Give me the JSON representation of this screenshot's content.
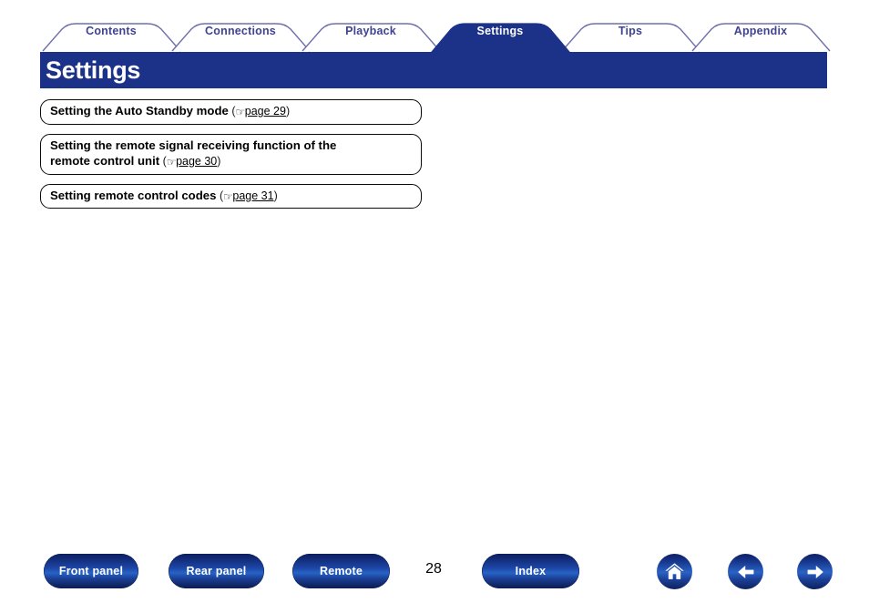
{
  "tabs": [
    {
      "label": "Contents",
      "active": false
    },
    {
      "label": "Connections",
      "active": false
    },
    {
      "label": "Playback",
      "active": false
    },
    {
      "label": "Settings",
      "active": true
    },
    {
      "label": "Tips",
      "active": false
    },
    {
      "label": "Appendix",
      "active": false
    }
  ],
  "header": {
    "title": "Settings",
    "bar_color": "#1b3288",
    "tab_border_color": "#6f70ab",
    "tab_text_color": "#404392"
  },
  "links": [
    {
      "lines": [
        "Setting the Auto Standby mode"
      ],
      "icon": "pointing-hand-icon",
      "page_ref": "page 29"
    },
    {
      "lines": [
        "Setting the remote signal receiving function of the",
        "remote control unit"
      ],
      "icon": "pointing-hand-icon",
      "page_ref": "page 30"
    },
    {
      "lines": [
        "Setting remote control codes"
      ],
      "icon": "pointing-hand-icon",
      "page_ref": "page 31"
    }
  ],
  "footer": {
    "buttons": [
      {
        "label": "Front panel"
      },
      {
        "label": "Rear panel"
      },
      {
        "label": "Remote"
      },
      {
        "label": "Index"
      }
    ],
    "page_number": "28",
    "icons": [
      {
        "name": "home-icon",
        "title": "Home"
      },
      {
        "name": "arrow-left-icon",
        "title": "Previous page"
      },
      {
        "name": "arrow-right-icon",
        "title": "Next page"
      }
    ]
  }
}
